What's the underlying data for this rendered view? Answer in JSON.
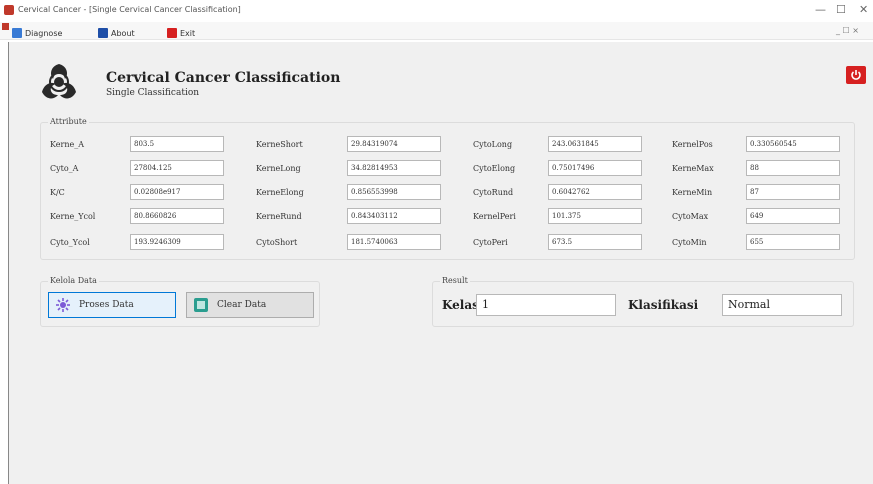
{
  "window": {
    "title": "Cervical Cancer - [Single Cervical Cancer Classification]",
    "minimize": "—",
    "maximize": "☐",
    "close": "✕",
    "mdi_controls": "_ ☐ ×"
  },
  "menu": {
    "items": [
      {
        "label": "Diagnose",
        "icon": "diagnose-icon",
        "color": "#3a7bd5"
      },
      {
        "label": "About",
        "icon": "about-icon",
        "color": "#1f4fa8"
      },
      {
        "label": "Exit",
        "icon": "exit-icon",
        "color": "#d62020"
      }
    ]
  },
  "header": {
    "title": "Cervical Cancer Classification",
    "subtitle": "Single Classification",
    "logo_icon": "biohazard-icon",
    "power_icon": "power-icon",
    "power_color": "#d62020"
  },
  "attributes": {
    "group_label": "Attribute",
    "rows": [
      [
        {
          "label": "Kerne_A",
          "value": "803.5"
        },
        {
          "label": "KerneShort",
          "value": "29.84319074"
        },
        {
          "label": "CytoLong",
          "value": "243.0631845"
        },
        {
          "label": "KernelPos",
          "value": "0.330560545"
        }
      ],
      [
        {
          "label": "Cyto_A",
          "value": "27804.125"
        },
        {
          "label": "KerneLong",
          "value": "34.82814953"
        },
        {
          "label": "CytoElong",
          "value": "0.75017496"
        },
        {
          "label": "KerneMax",
          "value": "88"
        }
      ],
      [
        {
          "label": "K/C",
          "value": "0.02808e917"
        },
        {
          "label": "KerneElong",
          "value": "0.856553998"
        },
        {
          "label": "CytoRund",
          "value": "0.6042762"
        },
        {
          "label": "KerneMin",
          "value": "87"
        }
      ],
      [
        {
          "label": "Kerne_Ycol",
          "value": "80.8660826"
        },
        {
          "label": "KerneRund",
          "value": "0.843403112"
        },
        {
          "label": "KernelPeri",
          "value": "101.375"
        },
        {
          "label": "CytoMax",
          "value": "649"
        }
      ],
      [
        {
          "label": "Cyto_Ycol",
          "value": "193.9246309"
        },
        {
          "label": "CytoShort",
          "value": "181.5740063"
        },
        {
          "label": "CytoPeri",
          "value": "673.5"
        },
        {
          "label": "CytoMin",
          "value": "655"
        }
      ]
    ]
  },
  "data_group": {
    "label": "Kelola Data",
    "process_button": "Proses Data",
    "process_icon": "process-icon",
    "clear_button": "Clear Data",
    "clear_icon": "clear-icon"
  },
  "result": {
    "group_label": "Result",
    "kelas_label": "Kelas",
    "kelas_value": "1",
    "klasifikasi_label": "Klasifikasi",
    "klasifikasi_value": "Normal"
  }
}
